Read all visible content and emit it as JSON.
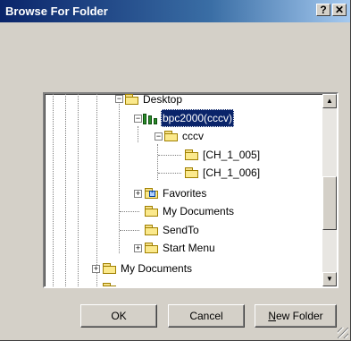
{
  "window": {
    "title": "Browse For Folder",
    "help_label": "?",
    "close_label": "✕"
  },
  "tree": {
    "nodes": [
      {
        "label": "Desktop",
        "expander": "−",
        "icon": "folder-icon"
      },
      {
        "label": "bpc2000(cccv)",
        "expander": "−",
        "icon": "network-drive-icon",
        "selected": true
      },
      {
        "label": "cccv",
        "expander": "−",
        "icon": "folder-icon"
      },
      {
        "label": "[CH_1_005]",
        "icon": "folder-icon"
      },
      {
        "label": "[CH_1_006]",
        "icon": "folder-icon"
      },
      {
        "label": "Favorites",
        "expander": "+",
        "icon": "favorites-folder-icon"
      },
      {
        "label": "My Documents",
        "icon": "folder-icon"
      },
      {
        "label": "SendTo",
        "icon": "folder-icon"
      },
      {
        "label": "Start Menu",
        "expander": "+",
        "icon": "folder-icon"
      },
      {
        "label": "My Documents",
        "expander": "+",
        "icon": "folder-icon"
      }
    ]
  },
  "buttons": {
    "ok": "OK",
    "cancel": "Cancel",
    "new_folder_accel": "N",
    "new_folder_rest": "ew Folder"
  },
  "scrollbar": {
    "up_glyph": "▲",
    "down_glyph": "▼"
  }
}
